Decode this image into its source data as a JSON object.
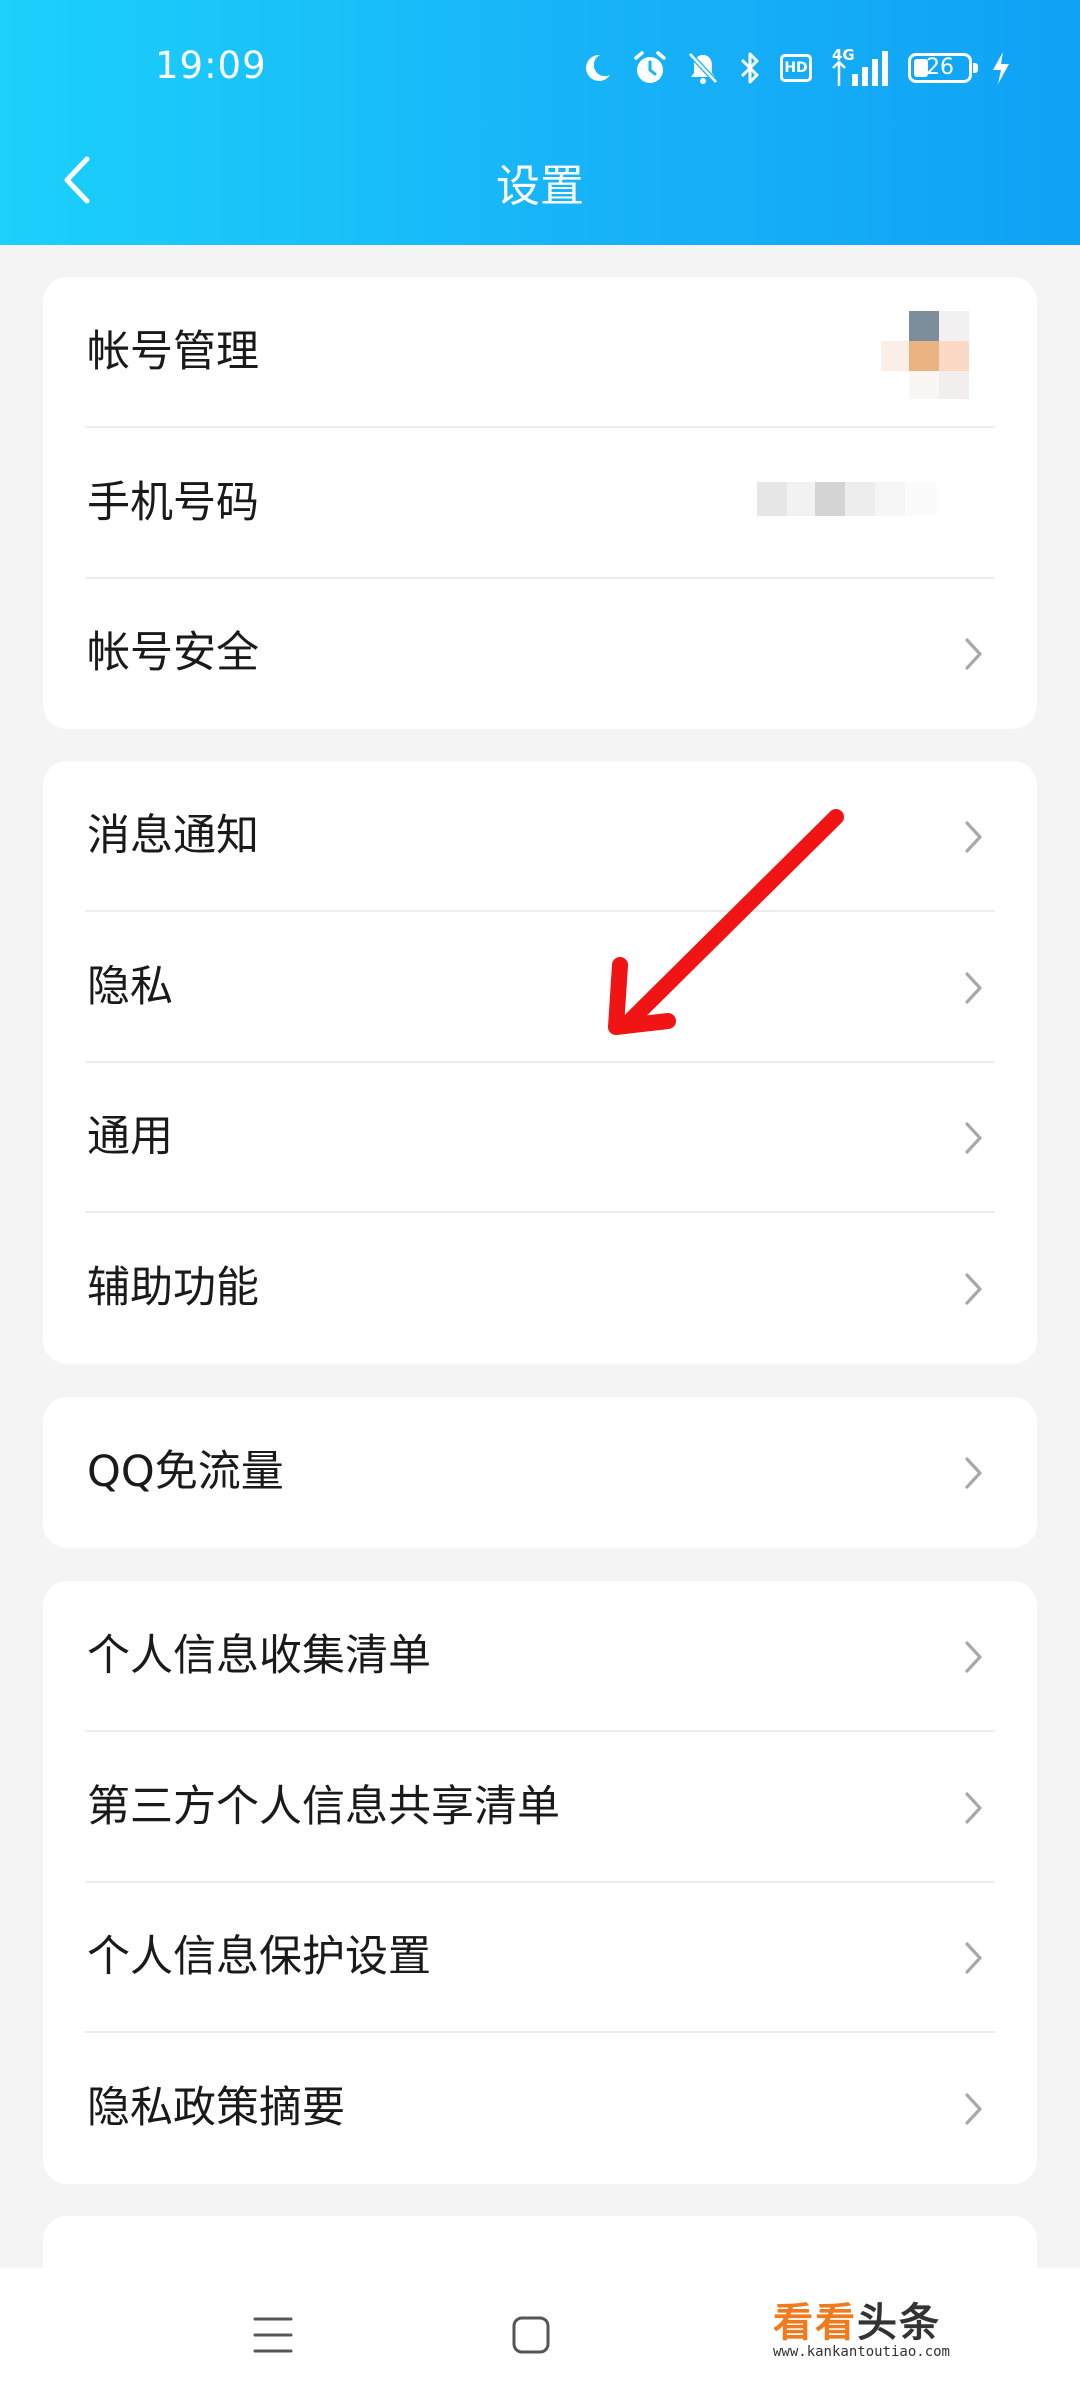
{
  "status_bar": {
    "time": "19:09",
    "network": "4G",
    "hd": "HD",
    "battery": "26",
    "battery_level": 0.26,
    "icons": [
      "moon-icon",
      "alarm-icon",
      "mute-icon",
      "bluetooth-icon",
      "hd-icon",
      "signal-icon",
      "battery-icon",
      "charging-icon"
    ]
  },
  "header": {
    "title": "设置",
    "back_icon": "chevron-left-icon"
  },
  "groups": [
    {
      "items": [
        {
          "label": "帐号管理"
        },
        {
          "label": "手机号码"
        },
        {
          "label": "帐号安全"
        }
      ]
    },
    {
      "items": [
        {
          "label": "消息通知"
        },
        {
          "label": "隐私"
        },
        {
          "label": "通用"
        },
        {
          "label": "辅助功能"
        }
      ]
    },
    {
      "items": [
        {
          "label": "QQ免流量"
        }
      ]
    },
    {
      "items": [
        {
          "label": "个人信息收集清单"
        },
        {
          "label": "第三方个人信息共享清单"
        },
        {
          "label": "个人信息保护设置"
        },
        {
          "label": "隐私政策摘要"
        }
      ]
    }
  ],
  "bottom_nav": {
    "icons": [
      "menu-icon",
      "home-square-icon"
    ]
  },
  "watermark": {
    "main_orange": "看看",
    "main_dark": "头条",
    "sub": "www.kankantoutiao.com"
  },
  "colors": {
    "header_start": "#1bd0fb",
    "header_end": "#10a2f5",
    "background": "#f4f4f4",
    "card": "#ffffff",
    "text": "#1a1a1a",
    "chevron": "#a8a8a8",
    "annotation_arrow": "#f01414",
    "watermark_orange": "#f07a1e"
  }
}
